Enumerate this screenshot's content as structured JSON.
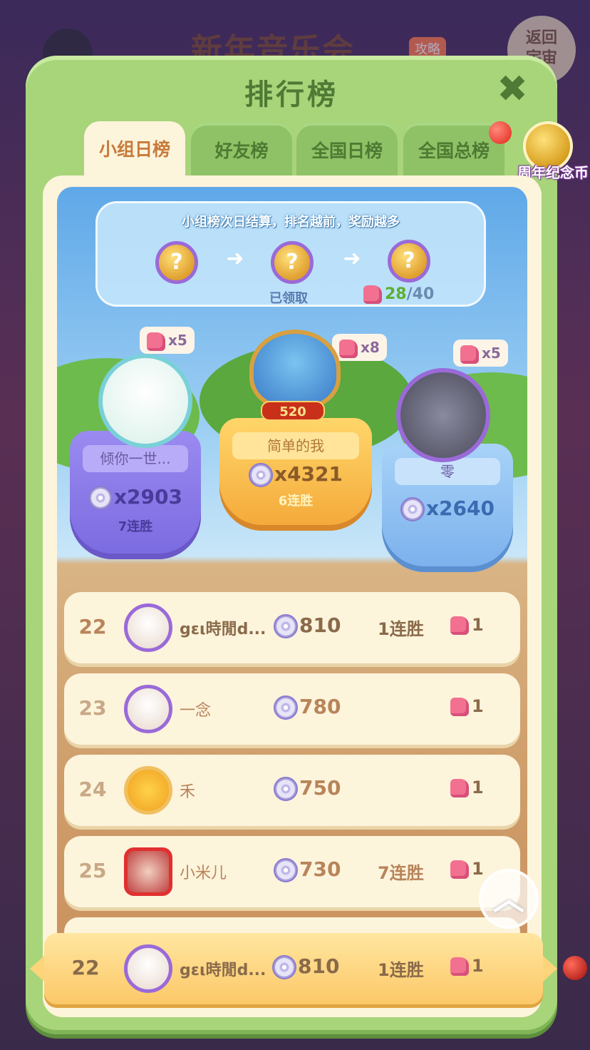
{
  "background": {
    "title": "新年音乐会",
    "tag": "攻略",
    "back_button": "返回\n宇宙"
  },
  "panel": {
    "title": "排行榜",
    "close_icon": "close-icon"
  },
  "tabs": [
    {
      "label": "小组日榜",
      "active": true
    },
    {
      "label": "好友榜",
      "active": false
    },
    {
      "label": "全国日榜",
      "active": false
    },
    {
      "label": "全国总榜",
      "active": false
    }
  ],
  "coin_badge": {
    "label": "周年纪念币"
  },
  "banner": {
    "text": "小组榜次日结算，排名越前，奖励越多",
    "claimed": "已领取",
    "progress_current": "28",
    "progress_total": "/40"
  },
  "podium": {
    "first": {
      "name": "简单的我",
      "score": "x4321",
      "streak": "6连胜",
      "reward": "x8",
      "badge": "520"
    },
    "second": {
      "name": "倾你一世...",
      "score": "x2903",
      "streak": "7连胜",
      "reward": "x5"
    },
    "third": {
      "name": "零",
      "score": "x2640",
      "streak": "",
      "reward": "x5"
    }
  },
  "rows": [
    {
      "rank": "22",
      "name": "gɛι時閒d...",
      "score": "810",
      "streak": "1连胜",
      "pieces": "1"
    },
    {
      "rank": "23",
      "name": "一念",
      "score": "780",
      "streak": "",
      "pieces": "1"
    },
    {
      "rank": "24",
      "name": "禾",
      "score": "750",
      "streak": "",
      "pieces": "1"
    },
    {
      "rank": "25",
      "name": "小米儿",
      "score": "730",
      "streak": "7连胜",
      "pieces": "1"
    }
  ],
  "me": {
    "rank": "22",
    "name": "gɛι時閒d...",
    "score": "810",
    "streak": "1连胜",
    "pieces": "1"
  },
  "colors": {
    "panel": "#a8d47a",
    "accent": "#f4a838",
    "purple": "#9a6ad8"
  }
}
